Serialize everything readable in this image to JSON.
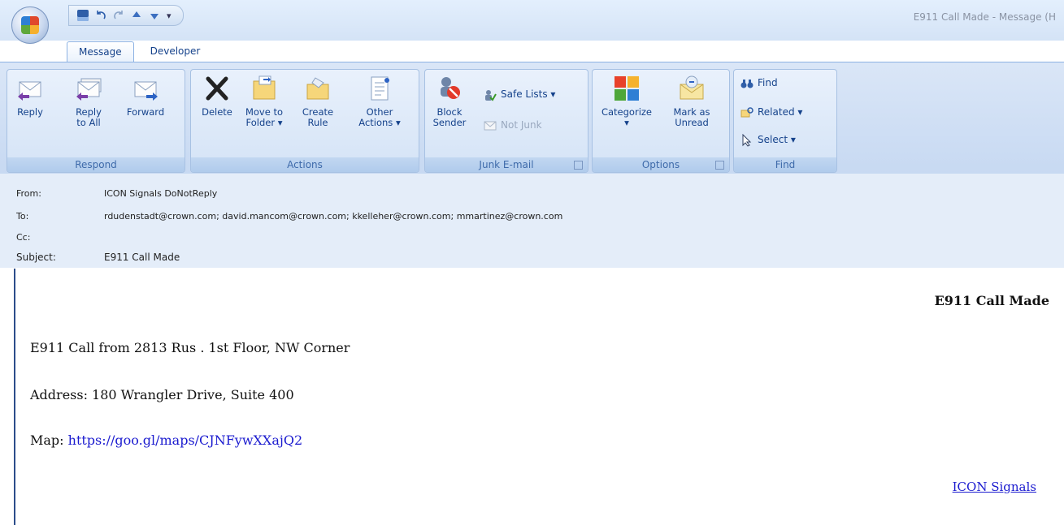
{
  "window": {
    "title": "E911 Call Made - Message (H",
    "qat_separator": "▾"
  },
  "tabs": [
    {
      "label": "Message",
      "active": true
    },
    {
      "label": "Developer",
      "active": false
    }
  ],
  "ribbon": {
    "groups": {
      "respond": "Respond",
      "actions": "Actions",
      "junk": "Junk E-mail",
      "options": "Options",
      "find": "Find"
    },
    "buttons": {
      "reply": "Reply",
      "reply_all_1": "Reply",
      "reply_all_2": "to All",
      "forward": "Forward",
      "delete": "Delete",
      "move_1": "Move to",
      "move_2": "Folder ▾",
      "create_1": "Create",
      "create_2": "Rule",
      "other_1": "Other",
      "other_2": "Actions ▾",
      "block_1": "Block",
      "block_2": "Sender",
      "safe_lists": "Safe Lists ▾",
      "not_junk": "Not Junk",
      "categorize_1": "Categorize",
      "categorize_2": "▾",
      "mark_1": "Mark as",
      "mark_2": "Unread",
      "find": "Find",
      "related": "Related ▾",
      "select": "Select ▾"
    }
  },
  "headers": {
    "from_label": "From:",
    "from_value": "ICON Signals DoNotReply",
    "to_label": "To:",
    "to_value": "rdudenstadt@crown.com; david.mancom@crown.com; kkelleher@crown.com; mmartinez@crown.com",
    "cc_label": "Cc:",
    "cc_value": "",
    "subject_label": "Subject:",
    "subject_value": "E911 Call Made"
  },
  "body": {
    "title": "E911 Call Made",
    "line1": "E911 Call from 2813 Rus . 1st Floor, NW Corner",
    "line2": "Address: 180 Wrangler Drive, Suite 400",
    "map_label": "Map: ",
    "map_link": "https://goo.gl/maps/CJNFywXXajQ2",
    "footer_link": "ICON Signals"
  }
}
